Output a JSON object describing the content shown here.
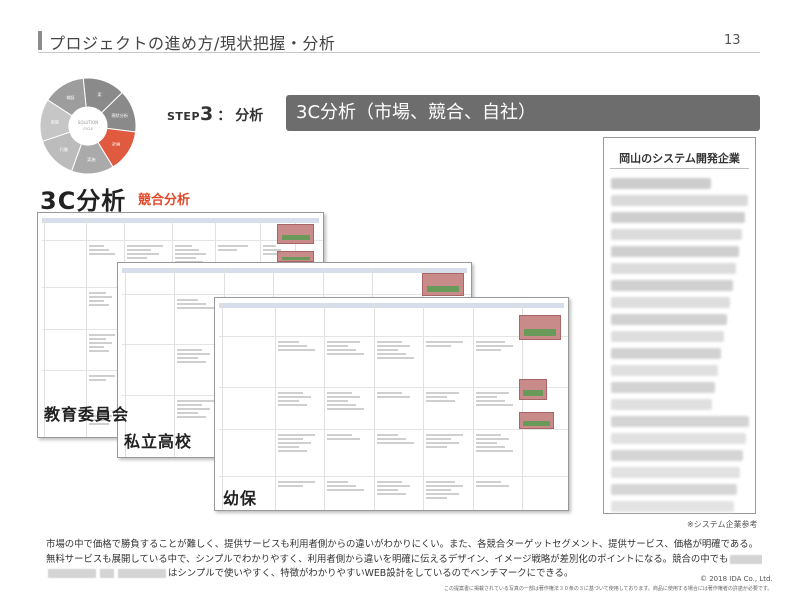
{
  "header": {
    "title": "プロジェクトの進め方/現状把握・分析",
    "page_number": "13"
  },
  "cycle": {
    "center_line1": "SOLUTION",
    "center_line2": "CYCLE",
    "segments": [
      {
        "label": "実",
        "color": "#8a8a8a"
      },
      {
        "label": "現状分析",
        "color": "#8a8a8a"
      },
      {
        "label": "計画",
        "color": "#e05a3f"
      },
      {
        "label": "実施",
        "color": "#aaaaaa"
      },
      {
        "label": "行動",
        "color": "#bcbcbc"
      },
      {
        "label": "実装",
        "color": "#c6c6c6"
      },
      {
        "label": "検証",
        "color": "#9d9d9d"
      }
    ]
  },
  "step": {
    "prefix": "STEP",
    "number": "3",
    "colon": "：",
    "name": "分析"
  },
  "banner": "3C分析（市場、競合、自社）",
  "side_list": {
    "title": "岡山のシステム開発企業",
    "redacted_rows": 20
  },
  "section": {
    "title": "3C分析",
    "subtitle": "競合分析"
  },
  "sheets": [
    "教育委員会",
    "私立高校",
    "幼保"
  ],
  "footer": {
    "reference": "※システム企業参考",
    "line1": "市場の中で価格で勝負することが難しく、提供サービスも利用者側からの違いがわかりにくい。また、各競合ターゲットセグメント、提供サービス、価格が明確である。",
    "line2": "無料サービスも展開している中で、シンプルでわかりやすく、利用者側から違いを明確に伝えるデザイン、イメージ戦略が差別化のポイントになる。競合の中でも",
    "line3": "はシンプルで使いやすく、特徴がわかりやすいWEB設計をしているのでベンチマークにできる。",
    "copyright": "© 2018 IDA Co., Ltd.",
    "note": "この提案書に掲載されている写真の一部は著作権法３０条の３に基づいて使用しております。商品に使用する場合には著作権者の許諾が必要です。"
  },
  "colors": {
    "accent": "#e04a2a",
    "banner": "#6d6d6d"
  }
}
